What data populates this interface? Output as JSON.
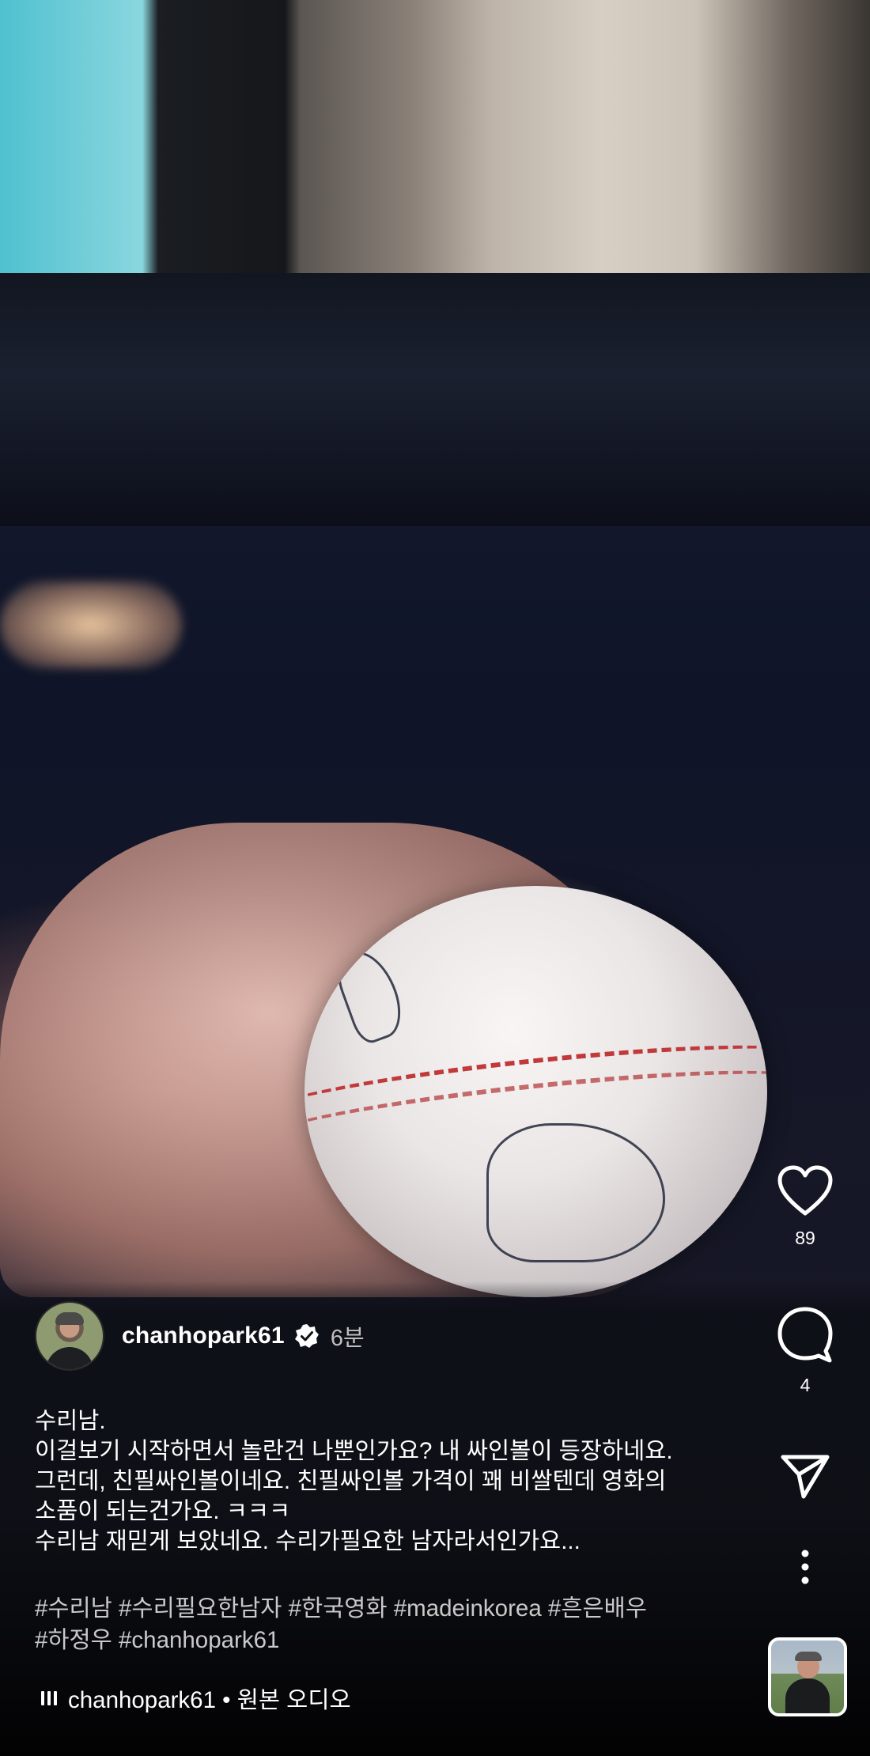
{
  "post": {
    "username": "chanhopark61",
    "time_ago": "6분",
    "caption": "수리남.\n이걸보기 시작하면서 놀란건 나뿐인가요? 내 싸인볼이 등장하네요.\n그런데,  친필싸인볼이네요.  친필싸인볼 가격이 꽤 비쌀텐데 영화의\n소품이 되는건가요. ㅋㅋㅋ\n수리남 재믿게 보았네요.  수리가필요한 남자라서인가요...",
    "hashtags": "#수리남 #수리필요한남자 #한국영화 #madeinkorea #흔은배우\n#하정우 #chanhopark61",
    "audio_label": "chanhopark61 • 원본 오디오"
  },
  "actions": {
    "like_count": "89",
    "comment_count": "4"
  },
  "icons": {
    "like": "heart-icon",
    "comment": "comment-bubble-icon",
    "share": "paper-plane-icon",
    "more": "more-vertical-icon",
    "verified": "verified-badge-icon",
    "audio": "audio-bars-icon"
  },
  "colors": {
    "verified_badge": "#ffffff",
    "hashtag_text": "#c9c9c9",
    "time_text": "#bfbfbf"
  }
}
